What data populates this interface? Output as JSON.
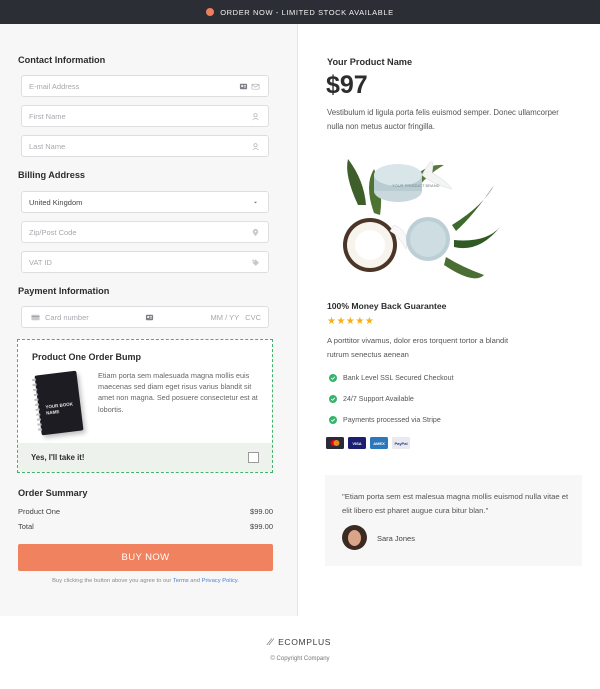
{
  "announcement": {
    "text": "ORDER NOW - LIMITED STOCK AVAILABLE"
  },
  "checkout": {
    "contact": {
      "title": "Contact Information",
      "email_placeholder": "E-mail Address",
      "first_name_placeholder": "First Name",
      "last_name_placeholder": "Last Name"
    },
    "billing": {
      "title": "Billing Address",
      "country": "United Kingdom",
      "zip_placeholder": "Zip/Post Code",
      "vat_placeholder": "VAT ID"
    },
    "payment": {
      "title": "Payment Information",
      "card_placeholder": "Card number",
      "expiry_placeholder": "MM / YY",
      "cvc_placeholder": "CVC"
    },
    "order_bump": {
      "title": "Product One Order Bump",
      "book_cover_text": "YOUR BOOK NAME",
      "description": "Etiam porta sem malesuada magna mollis euis maecenas sed diam eget risus varius blandit sit amet non magna. Sed posuere consectetur est at lobortis.",
      "accept_label": "Yes, I'll take it!",
      "checked": false
    },
    "summary": {
      "title": "Order Summary",
      "rows": [
        {
          "label": "Product One",
          "amount": "$99.00"
        },
        {
          "label": "Total",
          "amount": "$99.00"
        }
      ]
    },
    "buy_button": "BUY NOW",
    "legal": {
      "prefix": "Buy clicking the button above you agree to our",
      "terms": "Terms",
      "and": "and",
      "privacy": "Privacy Policy."
    }
  },
  "product": {
    "name": "Your Product Name",
    "price": "$97",
    "description": "Vestibulum id ligula porta felis euismod semper. Donec ullamcorper nulla non metus auctor fringilla.",
    "jar_label": "YOUR PRODUCT BRAND",
    "guarantee": {
      "title": "100% Money Back Guarantee",
      "stars": "★★★★★",
      "rating": 5,
      "text": "A porttitor vivamus, dolor eros torquent tortor a blandit rutrum senectus aenean"
    },
    "features": [
      "Bank Level SSL Secured Checkout",
      "24/7 Support Available",
      "Payments processed via Stripe"
    ],
    "payment_cards": [
      {
        "name": "mastercard",
        "label": "",
        "color": "#2b2b35"
      },
      {
        "name": "visa",
        "label": "VISA",
        "color": "#1a1f71"
      },
      {
        "name": "amex",
        "label": "AMEX",
        "color": "#2e77bc"
      },
      {
        "name": "paypal",
        "label": "PayPal",
        "color": "#e9e9ef"
      }
    ]
  },
  "testimonial": {
    "quote": "\"Etiam porta sem est malesua magna mollis euismod nulla vitae et elit libero est pharet augue cura bitur blan.\"",
    "author": "Sara Jones"
  },
  "footer": {
    "brand": "ECOMPLUS",
    "copyright": "© Copyright Company"
  },
  "colors": {
    "accent": "#f0825f",
    "topbar": "#2c2e36",
    "success": "#35b46b",
    "star": "#f3b01c"
  }
}
